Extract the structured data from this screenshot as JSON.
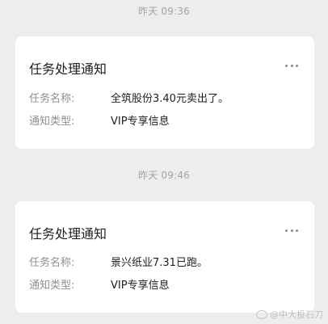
{
  "messages": [
    {
      "time": "昨天 09:36",
      "title": "任务处理通知",
      "fields": [
        {
          "key": "任务名称:",
          "value": "全筑股份3.40元卖出了。"
        },
        {
          "key": "通知类型:",
          "value": "VIP专享信息"
        }
      ]
    },
    {
      "time": "昨天 09:46",
      "title": "任务处理通知",
      "fields": [
        {
          "key": "任务名称:",
          "value": "景兴纸业7.31已跑。"
        },
        {
          "key": "通知类型:",
          "value": "VIP专享信息"
        }
      ]
    }
  ],
  "watermark": "@中大投石刀",
  "icons": {
    "more": "more-horizontal-icon",
    "watermark_logo": "weibo-logo-icon"
  }
}
